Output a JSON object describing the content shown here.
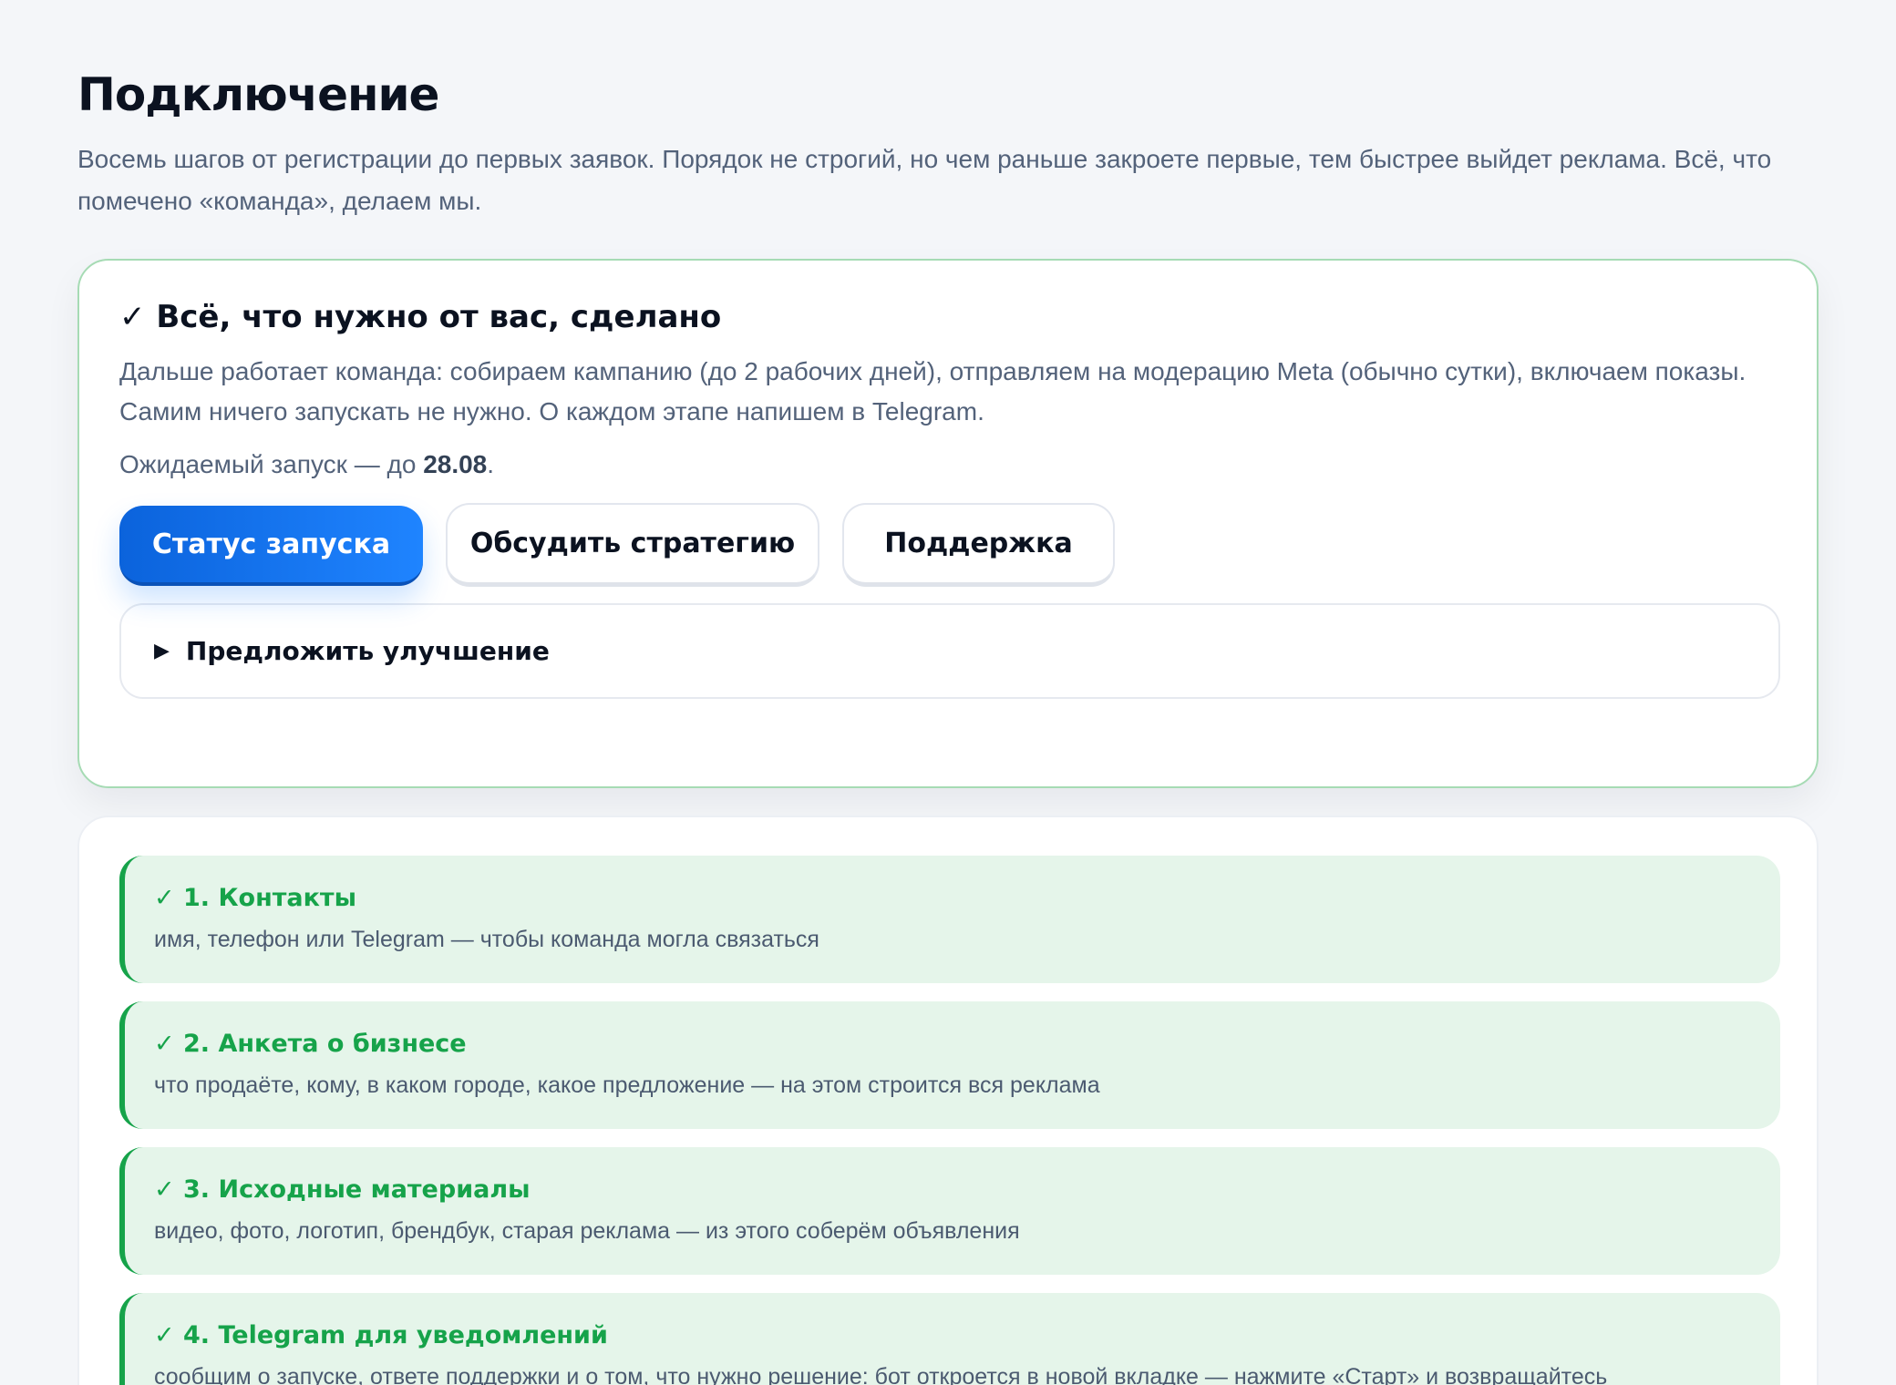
{
  "page": {
    "title": "Подключение",
    "subtitle": "Восемь шагов от регистрации до первых заявок. Порядок не строгий, но чем раньше закроете первые, тем быстрее выйдет реклама. Всё, что помечено «команда», делаем мы."
  },
  "done_card": {
    "title": "✓ Всё, что нужно от вас, сделано",
    "description": "Дальше работает команда: собираем кампанию (до 2 рабочих дней), отправляем на модерацию Meta (обычно сутки), включаем показы. Самим ничего запускать не нужно. О каждом этапе напишем в Telegram.",
    "launch_prefix": "Ожидаемый запуск — до ",
    "launch_date": "28.08",
    "launch_suffix": ".",
    "buttons": {
      "status": "Статус запуска",
      "strategy": "Обсудить стратегию",
      "support": "Поддержка"
    },
    "suggest": {
      "marker": "▶",
      "label": "Предложить улучшение"
    }
  },
  "steps": [
    {
      "title": "✓ 1. Контакты",
      "desc": "имя, телефон или Telegram — чтобы команда могла связаться"
    },
    {
      "title": "✓ 2. Анкета о бизнесе",
      "desc": "что продаёте, кому, в каком городе, какое предложение — на этом строится вся реклама"
    },
    {
      "title": "✓ 3. Исходные материалы",
      "desc": "видео, фото, логотип, брендбук, старая реклама — из этого соберём объявления"
    },
    {
      "title": "✓ 4. Telegram для уведомлений",
      "desc": "сообщим о запуске, ответе поддержки и о том, что нужно решение: бот откроется в новой вкладке — нажмите «Старт» и возвращайтесь"
    }
  ],
  "colors": {
    "accent": "#1f84ff",
    "success": "#16a34a",
    "success_bg": "#e5f5ea",
    "done_border": "#a6dbb4"
  }
}
